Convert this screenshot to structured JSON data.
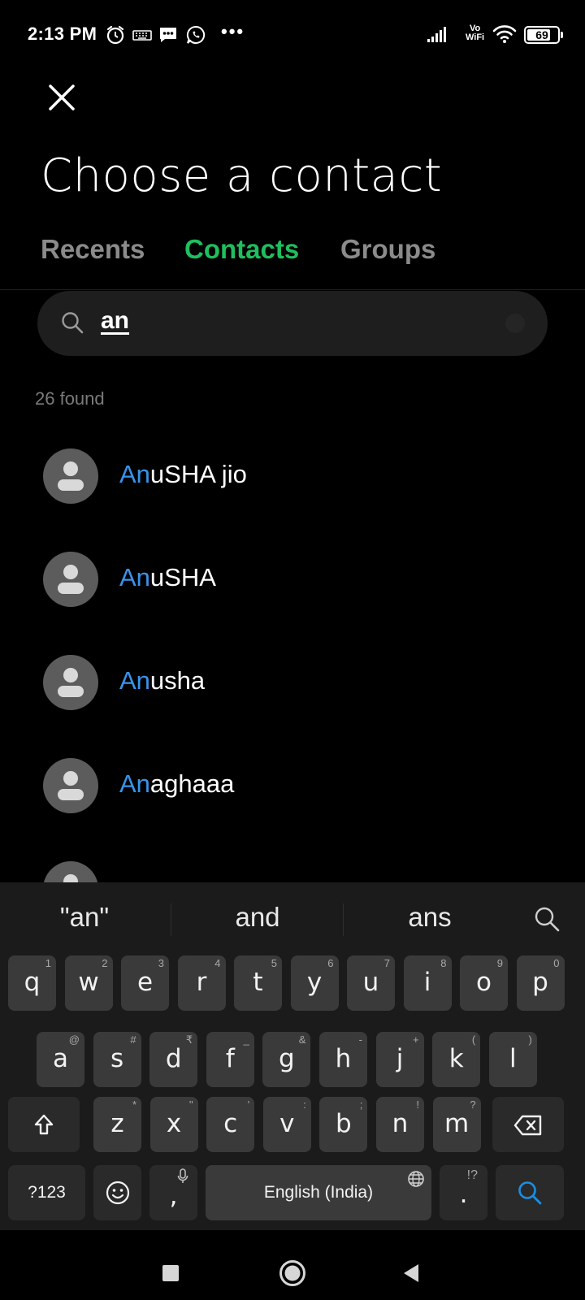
{
  "status_bar": {
    "time": "2:13 PM",
    "left_icons": [
      "alarm-icon",
      "keyboard-icon",
      "sms-icon",
      "whatsapp-icon"
    ],
    "more": "•••",
    "vowifi_top": "Vo",
    "vowifi_bottom": "WiFi",
    "battery": "69"
  },
  "header": {
    "close_icon": "close-icon",
    "title": "Choose a contact"
  },
  "tabs": [
    {
      "label": "Recents",
      "active": false
    },
    {
      "label": "Contacts",
      "active": true
    },
    {
      "label": "Groups",
      "active": false
    }
  ],
  "search": {
    "value": "an",
    "icon": "search-icon"
  },
  "results": {
    "count_text": "26 found"
  },
  "contacts": [
    {
      "match": "An",
      "rest": "uSHA jio"
    },
    {
      "match": "An",
      "rest": "uSHA"
    },
    {
      "match": "An",
      "rest": "usha"
    },
    {
      "match": "An",
      "rest": "aghaaa"
    },
    {
      "match": "",
      "rest": ""
    }
  ],
  "keyboard": {
    "suggestions": [
      "\"an\"",
      "and",
      "ans"
    ],
    "row1": [
      {
        "k": "q",
        "h": "1"
      },
      {
        "k": "w",
        "h": "2"
      },
      {
        "k": "e",
        "h": "3"
      },
      {
        "k": "r",
        "h": "4"
      },
      {
        "k": "t",
        "h": "5"
      },
      {
        "k": "y",
        "h": "6"
      },
      {
        "k": "u",
        "h": "7"
      },
      {
        "k": "i",
        "h": "8"
      },
      {
        "k": "o",
        "h": "9"
      },
      {
        "k": "p",
        "h": "0"
      }
    ],
    "row2": [
      {
        "k": "a",
        "h": "@"
      },
      {
        "k": "s",
        "h": "#"
      },
      {
        "k": "d",
        "h": "₹"
      },
      {
        "k": "f",
        "h": "_"
      },
      {
        "k": "g",
        "h": "&"
      },
      {
        "k": "h",
        "h": "-"
      },
      {
        "k": "j",
        "h": "+"
      },
      {
        "k": "k",
        "h": "("
      },
      {
        "k": "l",
        "h": ")"
      }
    ],
    "row3": [
      {
        "k": "z",
        "h": "*"
      },
      {
        "k": "x",
        "h": "\""
      },
      {
        "k": "c",
        "h": "'"
      },
      {
        "k": "v",
        "h": ":"
      },
      {
        "k": "b",
        "h": ";"
      },
      {
        "k": "n",
        "h": "!"
      },
      {
        "k": "m",
        "h": "?"
      }
    ],
    "symbols_key": "?123",
    "comma_key": ",",
    "space_label": "English (India)",
    "period_key": ".",
    "period_hint": "!?",
    "accent_color": "#1a8fe3"
  },
  "colors": {
    "active_tab": "#1fbf5e",
    "match_highlight": "#3a93ea"
  }
}
